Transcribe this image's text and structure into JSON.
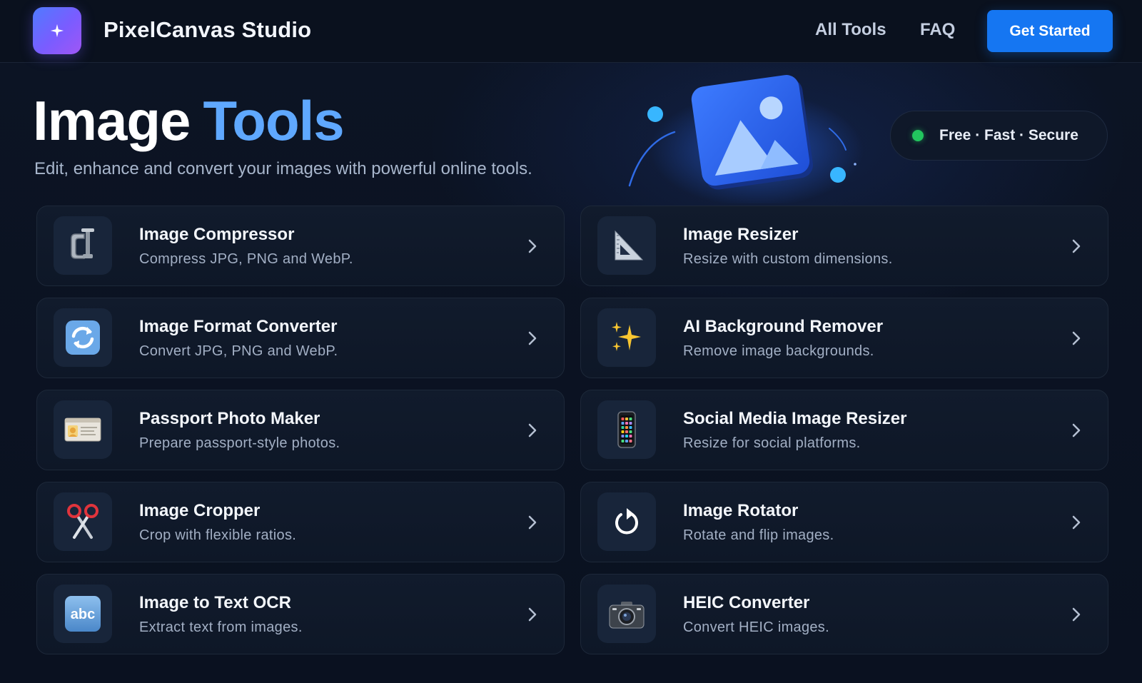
{
  "header": {
    "brand": "PixelCanvas Studio",
    "logo_icon": "sparkle-icon",
    "nav": [
      "All Tools",
      "FAQ"
    ],
    "cta_label": "Get Started"
  },
  "hero": {
    "title_part1": "Image",
    "title_part2": "Tools",
    "subtitle": "Edit, enhance and convert your images with powerful online tools.",
    "illustration_icon": "image-gallery-icon",
    "badge": "Free · Fast · Secure"
  },
  "tools": [
    {
      "title": "Image Compressor",
      "desc": "Compress JPG, PNG and WebP.",
      "icon": "clamp-icon"
    },
    {
      "title": "Image Resizer",
      "desc": "Resize with custom dimensions.",
      "icon": "triangle-ruler-icon"
    },
    {
      "title": "Image Format Converter",
      "desc": "Convert JPG, PNG and WebP.",
      "icon": "convert-arrows-icon"
    },
    {
      "title": "AI Background Remover",
      "desc": "Remove image backgrounds.",
      "icon": "sparkles-icon"
    },
    {
      "title": "Passport Photo Maker",
      "desc": "Prepare passport-style photos.",
      "icon": "id-card-icon"
    },
    {
      "title": "Social Media Image Resizer",
      "desc": "Resize for social platforms.",
      "icon": "smartphone-icon"
    },
    {
      "title": "Image Cropper",
      "desc": "Crop with flexible ratios.",
      "icon": "scissors-icon"
    },
    {
      "title": "Image Rotator",
      "desc": "Rotate and flip images.",
      "icon": "rotate-icon"
    },
    {
      "title": "Image to Text OCR",
      "desc": "Extract text from images.",
      "icon": "abc-icon"
    },
    {
      "title": "HEIC Converter",
      "desc": "Convert HEIC images.",
      "icon": "camera-icon"
    }
  ],
  "abc_icon_text": "abc",
  "colors": {
    "background": "#0b1220",
    "accent": "#1576f2",
    "title_accent": "#5fa8ff",
    "status_dot": "#22c55e"
  }
}
